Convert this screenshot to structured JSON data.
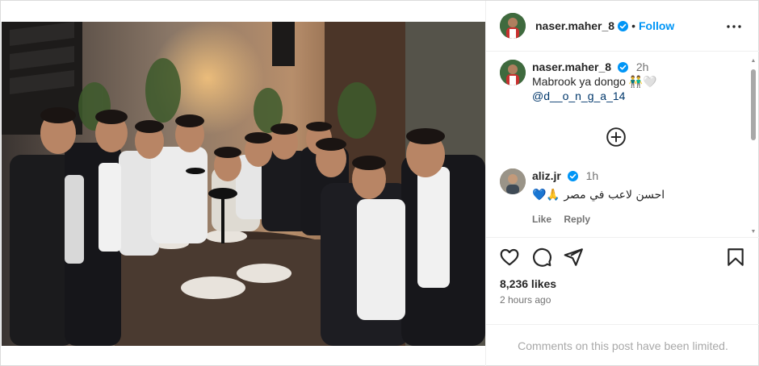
{
  "post": {
    "author": "naser.maher_8",
    "follow_label": "Follow",
    "separator": "•",
    "more_label": "More options"
  },
  "caption": {
    "username": "naser.maher_8",
    "time": "2h",
    "text": "Mabrook  ya dongo 👬🤍",
    "mention": "@d__o_n_g_a_14"
  },
  "comments": [
    {
      "username": "aliz.jr",
      "time": "1h",
      "text": "احسن لاعب في مصر 🙏💙",
      "like_label": "Like",
      "reply_label": "Reply"
    }
  ],
  "stats": {
    "likes": "8,236 likes",
    "time_ago": "2 hours ago"
  },
  "footer": {
    "limited_text": "Comments on this post have been limited."
  },
  "colors": {
    "link": "#0095f6",
    "verified": "#0095f6",
    "muted": "#737373",
    "text": "#262626",
    "mention": "#00376b"
  },
  "icons": [
    "verified-badge-icon",
    "more-icon",
    "add-circle-icon",
    "heart-icon",
    "comment-icon",
    "share-icon",
    "bookmark-icon"
  ]
}
